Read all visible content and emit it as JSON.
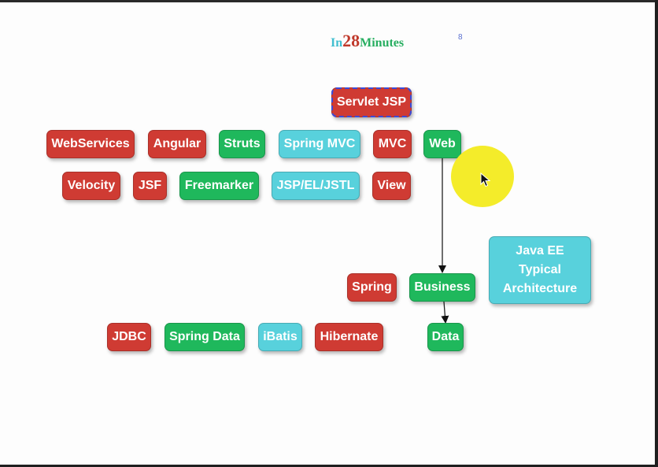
{
  "logo": {
    "part1": "In",
    "part2": "28",
    "part3": "Minutes"
  },
  "page_number": "8",
  "colors": {
    "red": "#cf3b33",
    "green": "#1fb85c",
    "cyan": "#58d1dc",
    "cursor_highlight": "#f4ec2a"
  },
  "nodes": {
    "servlet_jsp": "Servlet JSP",
    "webservices": "WebServices",
    "angular": "Angular",
    "struts": "Struts",
    "spring_mvc": "Spring MVC",
    "mvc": "MVC",
    "web": "Web",
    "velocity": "Velocity",
    "jsf": "JSF",
    "freemarker": "Freemarker",
    "jsp_el_jstl": "JSP/EL/JSTL",
    "view": "View",
    "java_ee": "Java EE Typical Architecture",
    "spring": "Spring",
    "business": "Business",
    "jdbc": "JDBC",
    "spring_data": "Spring Data",
    "ibatis": "iBatis",
    "hibernate": "Hibernate",
    "data": "Data"
  },
  "edges": [
    {
      "from": "Web",
      "to": "Business"
    },
    {
      "from": "Business",
      "to": "Data"
    }
  ]
}
